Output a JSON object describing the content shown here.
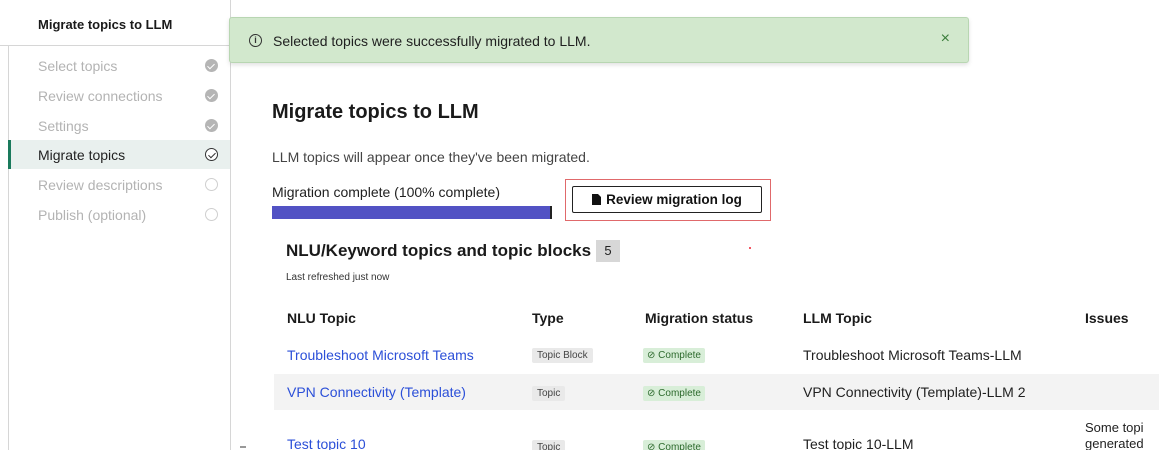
{
  "sidebar": {
    "title": "Migrate topics to LLM",
    "steps": [
      {
        "label": "Select topics",
        "state": "done"
      },
      {
        "label": "Review connections",
        "state": "done"
      },
      {
        "label": "Settings",
        "state": "done"
      },
      {
        "label": "Migrate topics",
        "state": "current"
      },
      {
        "label": "Review descriptions",
        "state": "pending"
      },
      {
        "label": "Publish (optional)",
        "state": "pending"
      }
    ]
  },
  "toast": {
    "icon": "info-circle-icon",
    "message": "Selected topics were successfully migrated to LLM.",
    "close": "×",
    "color": "#d2e8cd"
  },
  "main": {
    "title": "Migrate topics to LLM",
    "subtitle": "LLM topics will appear once they've been migrated.",
    "progress_label": "Migration complete (100% complete)",
    "progress_percent": 100,
    "progress_color": "#5252c4",
    "review_button": "Review migration log"
  },
  "section": {
    "title": "NLU/Keyword topics and topic blocks",
    "count": "5",
    "refreshed": "Last refreshed just now"
  },
  "table": {
    "headers": {
      "nlu_topic": "NLU Topic",
      "type": "Type",
      "status": "Migration status",
      "llm_topic": "LLM Topic",
      "issues": "Issues"
    },
    "rows": [
      {
        "nlu_topic": "Troubleshoot Microsoft Teams",
        "type": "Topic Block",
        "status": "Complete",
        "llm_topic": "Troubleshoot Microsoft Teams-LLM",
        "issues": ""
      },
      {
        "nlu_topic": "VPN Connectivity (Template)",
        "type": "Topic",
        "status": "Complete",
        "llm_topic": "VPN Connectivity (Template)-LLM 2",
        "issues": ""
      },
      {
        "nlu_topic": "Test topic 10",
        "type": "Topic",
        "status": "Complete",
        "llm_topic": "Test topic 10-LLM",
        "issues": "Some topi generated"
      }
    ]
  }
}
